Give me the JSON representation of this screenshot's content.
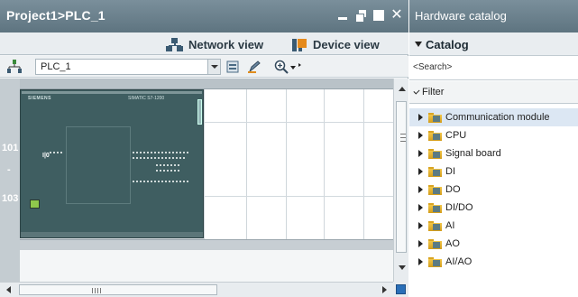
{
  "project_window": {
    "title": "Project1>PLC_1",
    "view_tabs": {
      "network": "Network view",
      "device": "Device view"
    },
    "toolbar": {
      "device_selected": "PLC_1"
    },
    "rail_numbers": [
      "101",
      "-",
      "103"
    ],
    "cpu_module": {
      "vendor": "SIEMENS",
      "model": "SIMATIC S7-1200",
      "status": "I|0"
    },
    "hscroll_grip": "III"
  },
  "catalog": {
    "title": "Hardware catalog",
    "header": "Catalog",
    "search_placeholder": "<Search>",
    "filter_label": "Filter",
    "items": [
      {
        "label": "Communication module",
        "selected": true
      },
      {
        "label": "CPU",
        "selected": false
      },
      {
        "label": "Signal board",
        "selected": false
      },
      {
        "label": "DI",
        "selected": false
      },
      {
        "label": "DO",
        "selected": false
      },
      {
        "label": "DI/DO",
        "selected": false
      },
      {
        "label": "AI",
        "selected": false
      },
      {
        "label": "AO",
        "selected": false
      },
      {
        "label": "AI/AO",
        "selected": false
      }
    ]
  },
  "colors": {
    "title_bar": "#6b808c",
    "cpu_body": "#3f5e61",
    "selection": "#dce7f3",
    "folder": "#f2c648"
  }
}
